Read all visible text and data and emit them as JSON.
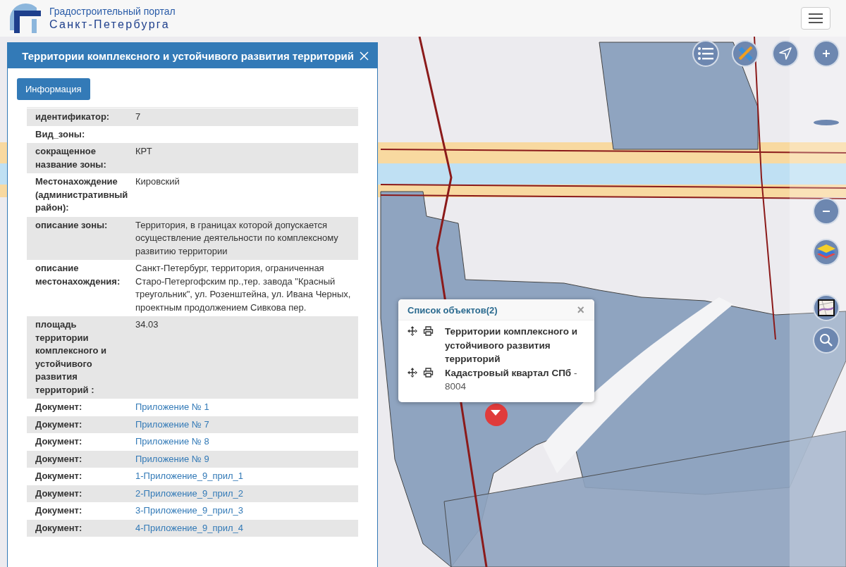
{
  "header": {
    "title_line_1": "Градостроительный портал",
    "title_line_2": "Санкт-Петербурга"
  },
  "panel": {
    "title": "Территории комплексного и устойчивого развития территорий",
    "tab_button": "Информация",
    "rows": [
      {
        "label": "идентификатор:",
        "value": "7",
        "kind": "text"
      },
      {
        "label": "Вид_зоны:",
        "value": "",
        "kind": "text"
      },
      {
        "label": "сокращенное название зоны:",
        "value": "КРТ",
        "kind": "text"
      },
      {
        "label": "Местонахождение (административный район):",
        "value": "Кировский",
        "kind": "text"
      },
      {
        "label": "описание зоны:",
        "value": "Территория, в границах которой допускается осуществление деятельности по комплексному развитию территории",
        "kind": "text"
      },
      {
        "label": "описание местонахождения:",
        "value": "Санкт-Петербург, территория, ограниченная Старо-Петергофским пр.,тер. завода \"Красный треугольник\", ул. Розенштейна, ул. Ивана Черных, проектным продолжением Сивкова пер.",
        "kind": "text"
      },
      {
        "label": "площадь территории комплексного и устойчивого развития территорий :",
        "value": "34.03",
        "kind": "text"
      },
      {
        "label": "Документ:",
        "value": "Приложение № 1",
        "kind": "link"
      },
      {
        "label": "Документ:",
        "value": "Приложение № 7",
        "kind": "link"
      },
      {
        "label": "Документ:",
        "value": "Приложение № 8",
        "kind": "link"
      },
      {
        "label": "Документ:",
        "value": "Приложение № 9",
        "kind": "link"
      },
      {
        "label": "Документ:",
        "value": "1-Приложение_9_прил_1",
        "kind": "link"
      },
      {
        "label": "Документ:",
        "value": "2-Приложение_9_прил_2",
        "kind": "link"
      },
      {
        "label": "Документ:",
        "value": "3-Приложение_9_прил_3",
        "kind": "link"
      },
      {
        "label": "Документ:",
        "value": "4-Приложение_9_прил_4",
        "kind": "link"
      }
    ]
  },
  "popup": {
    "title": "Список объектов(2)",
    "close": "×",
    "items": [
      {
        "name": "Территории комплексного и устойчивого развития территорий"
      },
      {
        "name": "Кадастровый квартал СПб",
        "suffix": " - 8004"
      }
    ]
  }
}
